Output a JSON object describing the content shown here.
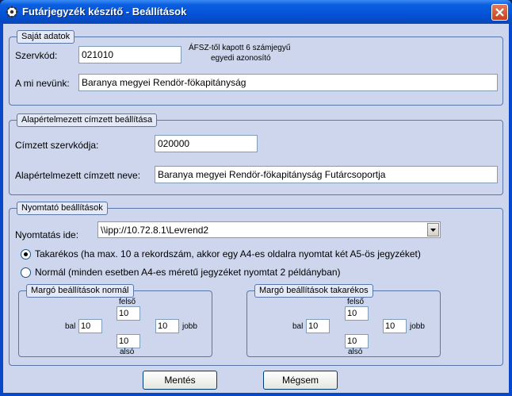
{
  "window": {
    "title": "Futárjegyzék készítő - Beállítások",
    "icon": "gear-icon"
  },
  "sajat": {
    "legend": "Saját adatok",
    "szervkod_label": "Szervkód:",
    "szervkod_value": "021010",
    "hint_line1": "ÁFSZ-től kapott 6 számjegyű",
    "hint_line2": "egyedi azonosító",
    "nev_label": "A mi nevünk:",
    "nev_value": "Baranya megyei Rendör-fökapitányság"
  },
  "cimzett": {
    "legend": "Alapértelmezett címzett beállítása",
    "szervkod_label": "Címzett szervkódja:",
    "szervkod_value": "020000",
    "nev_label": "Alapértelmezett címzett neve:",
    "nev_value": "Baranya megyei Rendör-fökapitányság Futárcsoportja"
  },
  "nyomtato": {
    "legend": "Nyomtató beállítások",
    "ide_label": "Nyomtatás ide:",
    "printer_value": "\\\\ipp://10.72.8.1\\Levrend2",
    "radio_takarekos": "Takarékos (ha max. 10 a rekordszám, akkor egy A4-es oldalra nyomtat két A5-ös jegyzéket)",
    "radio_normal": "Normál (minden esetben A4-es méretű jegyzéket nyomtat 2 példányban)",
    "selected": "takarekos"
  },
  "margo_normal": {
    "legend": "Margó beállítások normál",
    "felso_label": "felső",
    "felso": "10",
    "bal_label": "bal",
    "bal": "10",
    "jobb_label": "jobb",
    "jobb": "10",
    "also_label": "alsó",
    "also": "10"
  },
  "margo_takarekos": {
    "legend": "Margó beállítások takarékos",
    "felso_label": "felső",
    "felso": "10",
    "bal_label": "bal",
    "bal": "10",
    "jobb_label": "jobb",
    "jobb": "10",
    "also_label": "alsó",
    "also": "10"
  },
  "buttons": {
    "save": "Mentés",
    "cancel": "Mégsem"
  }
}
